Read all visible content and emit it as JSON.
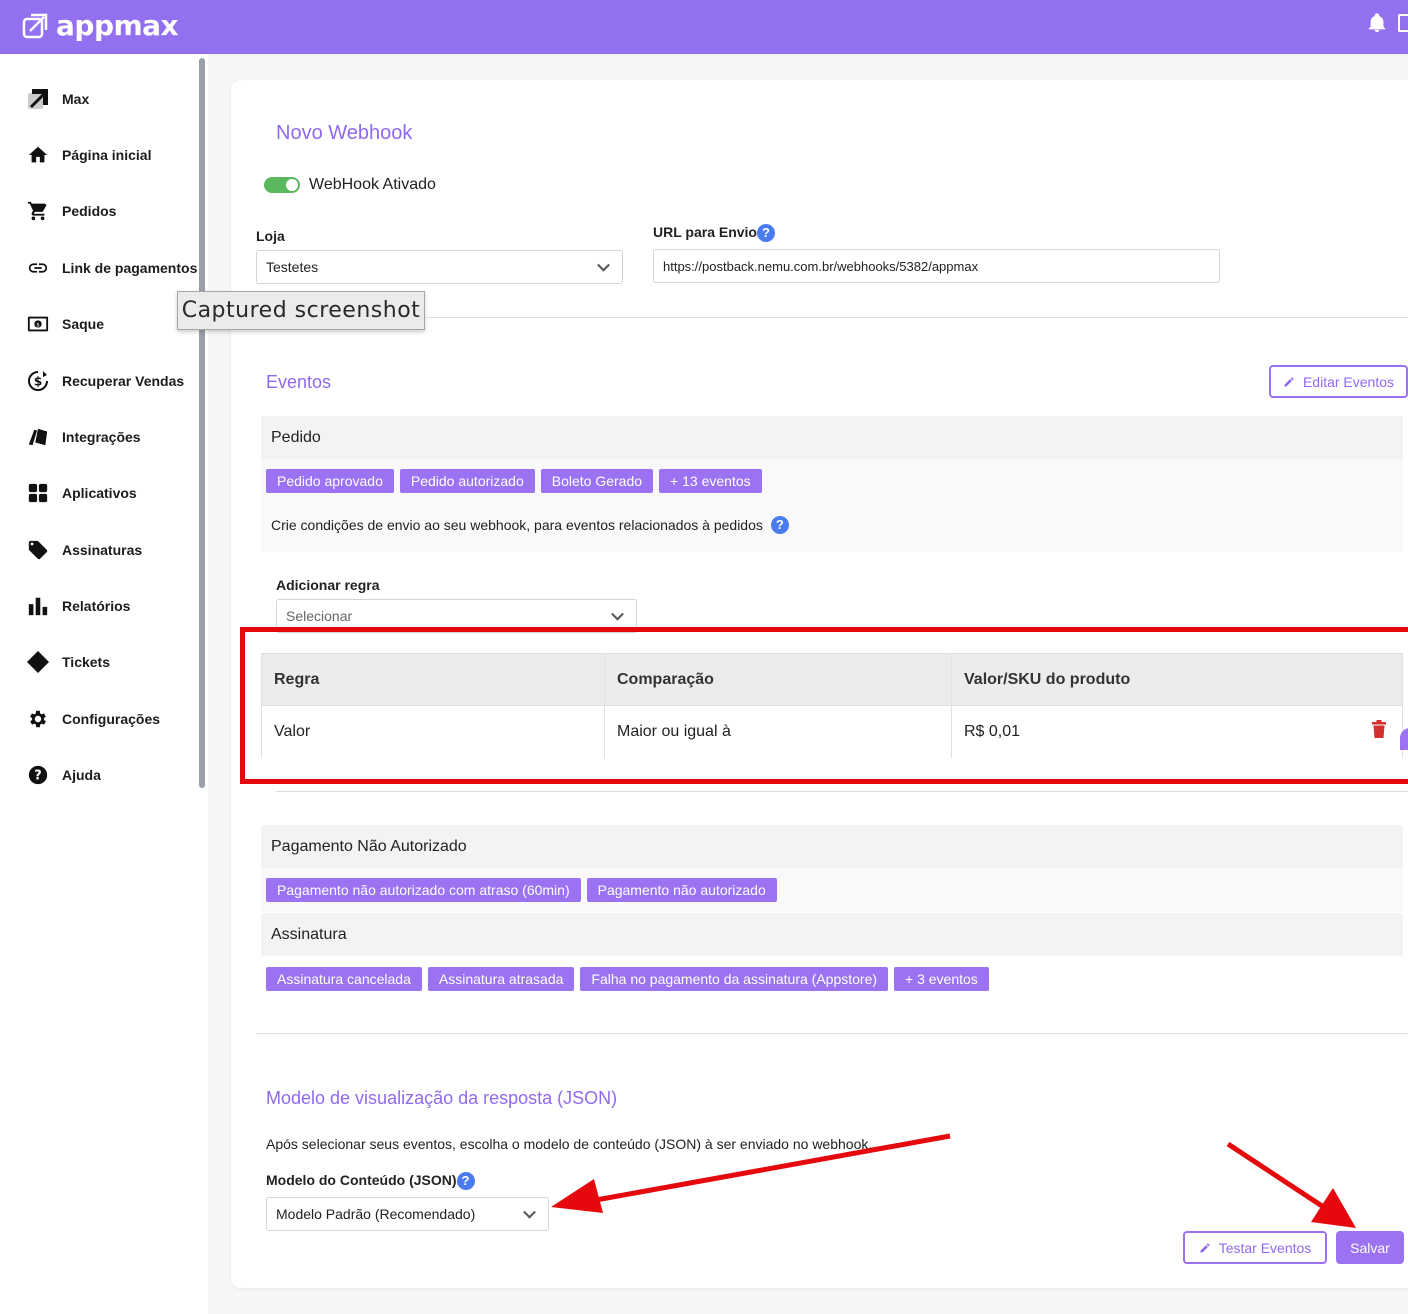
{
  "app": {
    "brand": "appmax",
    "accent": "#9370f0"
  },
  "sidebar": {
    "items": [
      {
        "label": "Max",
        "icon": "max-logo-icon"
      },
      {
        "label": "Página inicial",
        "icon": "home-icon"
      },
      {
        "label": "Pedidos",
        "icon": "cart-icon"
      },
      {
        "label": "Link de pagamentos",
        "icon": "link-icon"
      },
      {
        "label": "Saque",
        "icon": "cash-icon"
      },
      {
        "label": "Recuperar Vendas",
        "icon": "recover-money-icon"
      },
      {
        "label": "Integrações",
        "icon": "integrations-icon"
      },
      {
        "label": "Aplicativos",
        "icon": "apps-grid-icon"
      },
      {
        "label": "Assinaturas",
        "icon": "tag-icon"
      },
      {
        "label": "Relatórios",
        "icon": "bar-chart-icon"
      },
      {
        "label": "Tickets",
        "icon": "ticket-icon"
      },
      {
        "label": "Configurações",
        "icon": "gear-icon"
      },
      {
        "label": "Ajuda",
        "icon": "help-icon"
      }
    ]
  },
  "tooltip": "Captured screenshot",
  "form": {
    "title": "Novo Webhook",
    "toggle_label": "WebHook Ativado",
    "store_label": "Loja",
    "store_value": "Testetes",
    "url_label": "URL para Envio",
    "url_value": "https://postback.nemu.com.br/webhooks/5382/appmax"
  },
  "events": {
    "title": "Eventos",
    "edit_button": "Editar Eventos",
    "groups": [
      {
        "name": "Pedido",
        "chips": [
          "Pedido aprovado",
          "Pedido autorizado",
          "Boleto Gerado",
          "+ 13 eventos"
        ],
        "conditions_text": "Crie condições de envio ao seu webhook, para eventos relacionados à pedidos",
        "add_rule_label": "Adicionar regra",
        "add_rule_placeholder": "Selecionar"
      },
      {
        "name": "Pagamento Não Autorizado",
        "chips": [
          "Pagamento não autorizado com atraso (60min)",
          "Pagamento não autorizado"
        ]
      },
      {
        "name": "Assinatura",
        "chips": [
          "Assinatura cancelada",
          "Assinatura atrasada",
          "Falha no pagamento da assinatura (Appstore)",
          "+ 3 eventos"
        ]
      }
    ]
  },
  "rules_table": {
    "headers": [
      "Regra",
      "Comparação",
      "Valor/SKU do produto"
    ],
    "row": [
      "Valor",
      "Maior ou igual à",
      "R$ 0,01"
    ]
  },
  "json_section": {
    "title": "Modelo de visualização da resposta (JSON)",
    "description": "Após selecionar seus eventos, escolha o modelo de conteúdo (JSON) à ser enviado no webhook.",
    "model_label": "Modelo do Conteúdo (JSON)",
    "model_value": "Modelo Padrão (Recomendado)"
  },
  "actions": {
    "test_button": "Testar Eventos",
    "save_button": "Salvar"
  },
  "annotation_color": "#e5090d"
}
